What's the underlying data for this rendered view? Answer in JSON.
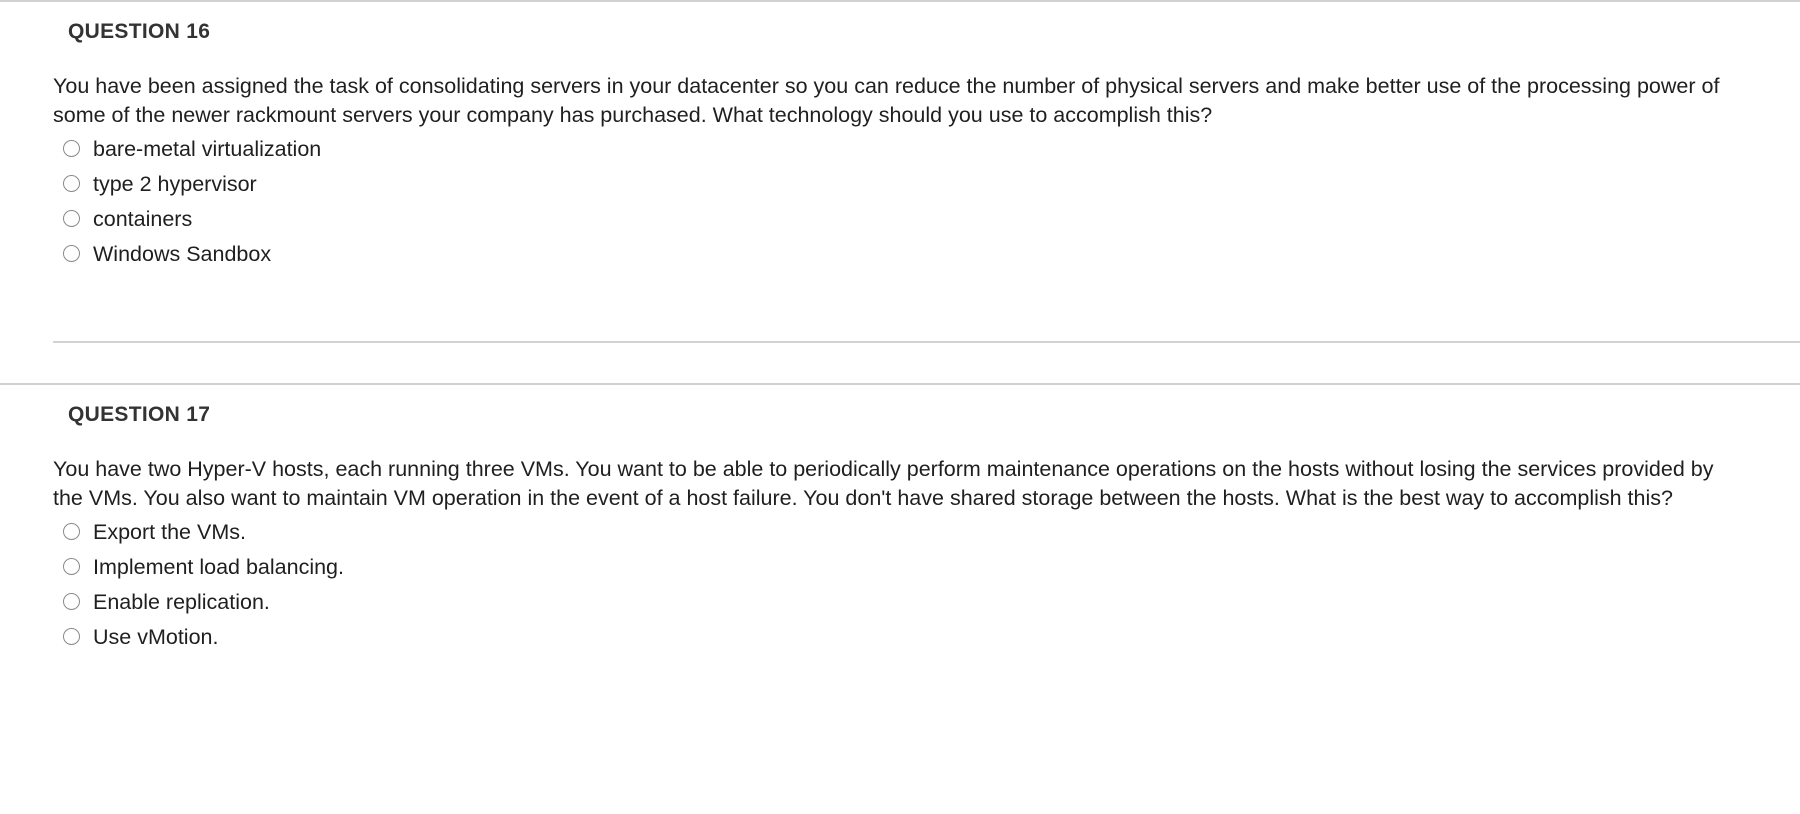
{
  "quiz": {
    "questions": [
      {
        "title": "QUESTION 16",
        "prompt": "You have been assigned the task of consolidating servers in your datacenter so you can reduce the number of physical servers and make better use of the processing power of some of the newer rackmount servers your company has purchased. What technology should you use to accomplish this?",
        "options": [
          {
            "label": "bare-metal virtualization",
            "selected": false
          },
          {
            "label": "type 2 hypervisor",
            "selected": false
          },
          {
            "label": "containers",
            "selected": false
          },
          {
            "label": "Windows Sandbox",
            "selected": false
          }
        ]
      },
      {
        "title": "QUESTION 17",
        "prompt": "You have two Hyper-V hosts, each running three VMs. You want to be able to periodically perform maintenance operations on the hosts without losing the services provided by the VMs. You also want to maintain VM operation in the event of a host failure. You don't have shared storage between the hosts. What is the best way to accomplish this?",
        "options": [
          {
            "label": "Export the VMs.",
            "selected": false
          },
          {
            "label": "Implement load balancing.",
            "selected": false
          },
          {
            "label": "Enable replication.",
            "selected": false
          },
          {
            "label": "Use vMotion.",
            "selected": false
          }
        ]
      }
    ]
  },
  "colors": {
    "divider": "#d2d2d2",
    "title_text": "#333333",
    "body_text": "#1f1f1f",
    "radio_border": "#8a8a8a",
    "background": "#ffffff"
  }
}
